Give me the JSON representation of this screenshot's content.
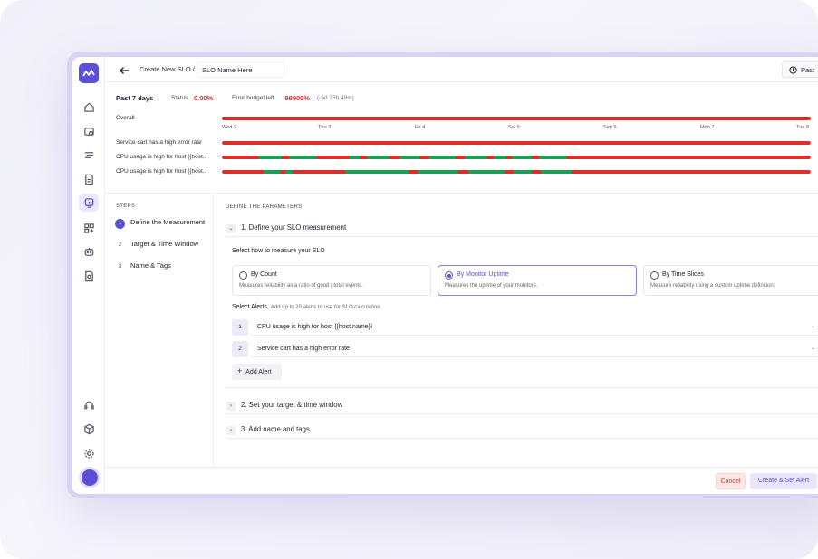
{
  "header": {
    "breadcrumb": "Create New SLO /",
    "slo_name": "SLO Name Here",
    "time_button": "Past"
  },
  "summary": {
    "period": "Past 7 days",
    "status_label": "Status",
    "status_value": "0.00%",
    "budget_label": "Error budget left",
    "budget_value": "-99900%",
    "budget_time": "(-6d 23h 49m)"
  },
  "timeline": {
    "overall_label": "Overall",
    "ticks": [
      "Wed 2",
      "Thu 3",
      "Fri 4",
      "Sat 5",
      "Sep 6",
      "Mon 7",
      "Tue 8"
    ],
    "rows": [
      {
        "label": "Service cart has a high error rate"
      },
      {
        "label": "CPU usage is high for host {{host..."
      },
      {
        "label": "CPU usage is high for host {{host..."
      }
    ],
    "colors": {
      "error": "#d9302a",
      "ok": "#1f9d57"
    }
  },
  "steps": {
    "title": "STEPS",
    "items": [
      {
        "num": "1",
        "label": "Define the Measurement"
      },
      {
        "num": "2",
        "label": "Target & Time Window"
      },
      {
        "num": "3",
        "label": "Name & Tags"
      }
    ]
  },
  "main": {
    "title": "DEFINE THE PARAMETERS",
    "section1": "1. Define your SLO measurement",
    "measure_label": "Select how to measure your SLO",
    "options": [
      {
        "title": "By Count",
        "desc": "Measures reliability as a ratio of good / total events."
      },
      {
        "title": "By Monitor Uptime",
        "desc": "Measures the uptime of your monitors."
      },
      {
        "title": "By Time Slices",
        "desc": "Measure reliability using a custom uptime definition."
      }
    ],
    "alerts_label": "Select Alerts",
    "alerts_hint": "Add up to 20 alerts to use for SLO calculation",
    "alerts": [
      {
        "num": "1",
        "value": "CPU usage is high for host {{host.name}}"
      },
      {
        "num": "2",
        "value": "Service cart has a high error rate"
      }
    ],
    "add_alert": "Add Alert",
    "section2": "2. Set your target & time window",
    "section3": "3. Add name and tags"
  },
  "footer": {
    "cancel": "Cancel",
    "create": "Create & Set Alert"
  },
  "accent": "#5a4fd6"
}
